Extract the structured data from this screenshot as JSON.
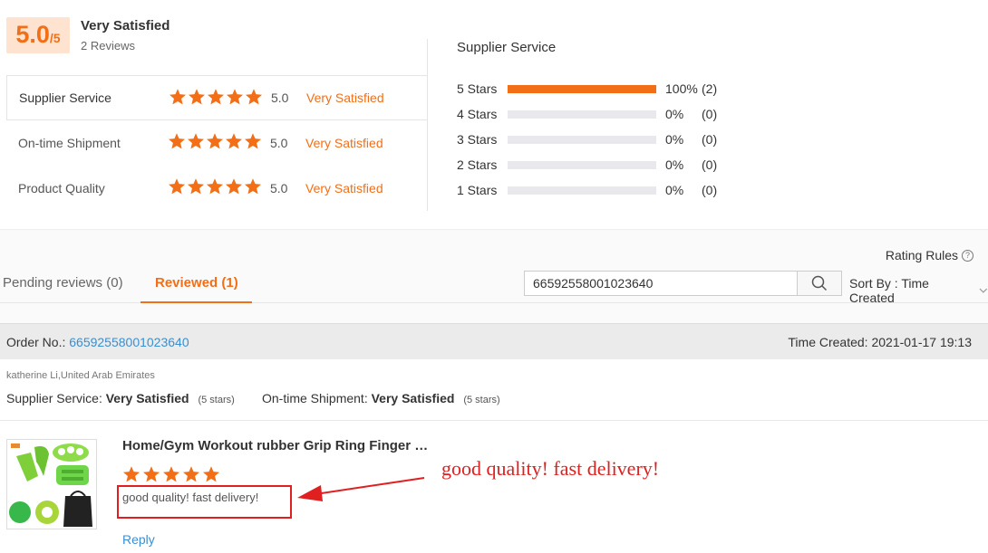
{
  "summary": {
    "score": "5.0",
    "score_denominator": "/5",
    "title": "Very Satisfied",
    "review_count": "2 Reviews",
    "dimensions": [
      {
        "label": "Supplier Service",
        "score": "5.0",
        "text": "Very Satisfied",
        "stars": 5
      },
      {
        "label": "On-time Shipment",
        "score": "5.0",
        "text": "Very Satisfied",
        "stars": 5
      },
      {
        "label": "Product Quality",
        "score": "5.0",
        "text": "Very Satisfied",
        "stars": 5
      }
    ]
  },
  "histogram": {
    "title": "Supplier Service",
    "rows": [
      {
        "label": "5  Stars",
        "fraction": 1.0,
        "pct": "100%",
        "count": "(2)"
      },
      {
        "label": "4  Stars",
        "fraction": 0,
        "pct": "0%",
        "count": "(0)"
      },
      {
        "label": "3  Stars",
        "fraction": 0,
        "pct": "0%",
        "count": "(0)"
      },
      {
        "label": "2  Stars",
        "fraction": 0,
        "pct": "0%",
        "count": "(0)"
      },
      {
        "label": "1  Stars",
        "fraction": 0,
        "pct": "0%",
        "count": "(0)"
      }
    ]
  },
  "toolbar": {
    "rating_rules": "Rating Rules",
    "tab_pending": "Pending reviews (0)",
    "tab_reviewed": "Reviewed (1)",
    "search_value": "66592558001023640",
    "sort_label": "Sort By : Time Created"
  },
  "order": {
    "label": "Order No.:",
    "number": "66592558001023640",
    "time_created": "Time Created: 2021-01-17 19:13",
    "buyer": "katherine Li,United Arab Emirates",
    "supplier_service_label": "Supplier Service:",
    "supplier_service_value": "Very Satisfied",
    "supplier_service_stars": "(5 stars)",
    "shipment_label": "On-time Shipment:",
    "shipment_value": "Very Satisfied",
    "shipment_stars": "(5 stars)"
  },
  "review": {
    "product_title": "Home/Gym Workout rubber Grip Ring Finger Ex...",
    "stars": 5,
    "text": "good quality!   fast delivery!",
    "reply": "Reply",
    "annotation": "good quality! fast delivery!"
  },
  "colors": {
    "accent": "#f26f17",
    "link": "#3a8fd0",
    "annotation": "#e02020"
  }
}
